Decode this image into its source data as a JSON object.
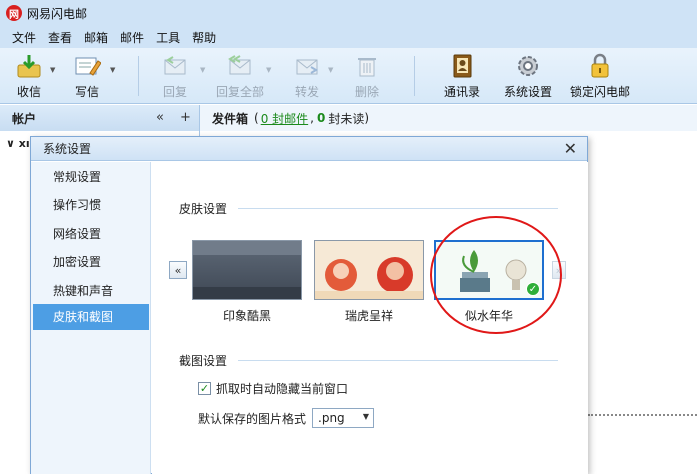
{
  "app": {
    "title": "网易闪电邮",
    "logo_glyph": "网"
  },
  "menu": [
    "文件",
    "查看",
    "邮箱",
    "邮件",
    "工具",
    "帮助"
  ],
  "toolbar": {
    "receive": "收信",
    "compose": "写信",
    "reply": "回复",
    "reply_all": "回复全部",
    "forward": "转发",
    "delete": "删除",
    "contacts": "通讯录",
    "settings": "系统设置",
    "lock": "锁定闪电邮"
  },
  "accounts": {
    "title": "帐户",
    "collapse": "«",
    "add": "+",
    "tree_item": "∨ xı"
  },
  "outbox": {
    "title": "发件箱",
    "open_paren": "(",
    "mail_count_link": "0 封邮件",
    "comma": ",",
    "unread_count": "0",
    "unread_text": "封未读",
    "close_paren": ")"
  },
  "dialog": {
    "title": "系统设置",
    "close": "✕",
    "nav": [
      "常规设置",
      "操作习惯",
      "网络设置",
      "加密设置",
      "热键和声音",
      "皮肤和截图"
    ],
    "active_nav_index": 5,
    "skin_section": {
      "title": "皮肤设置",
      "prev": "«",
      "next": "»",
      "skins": [
        "印象酷黑",
        "瑞虎呈祥",
        "似水年华"
      ],
      "selected_index": 2
    },
    "screenshot_section": {
      "title": "截图设置",
      "hide_window_label": "抓取时自动隐藏当前窗口",
      "hide_window_checked": true,
      "format_label": "默认保存的图片格式",
      "format_value": ".png"
    }
  },
  "colors": {
    "accent": "#4d9ee4",
    "highlight_circle": "#e01818",
    "link_green": "#1c8a1c"
  }
}
